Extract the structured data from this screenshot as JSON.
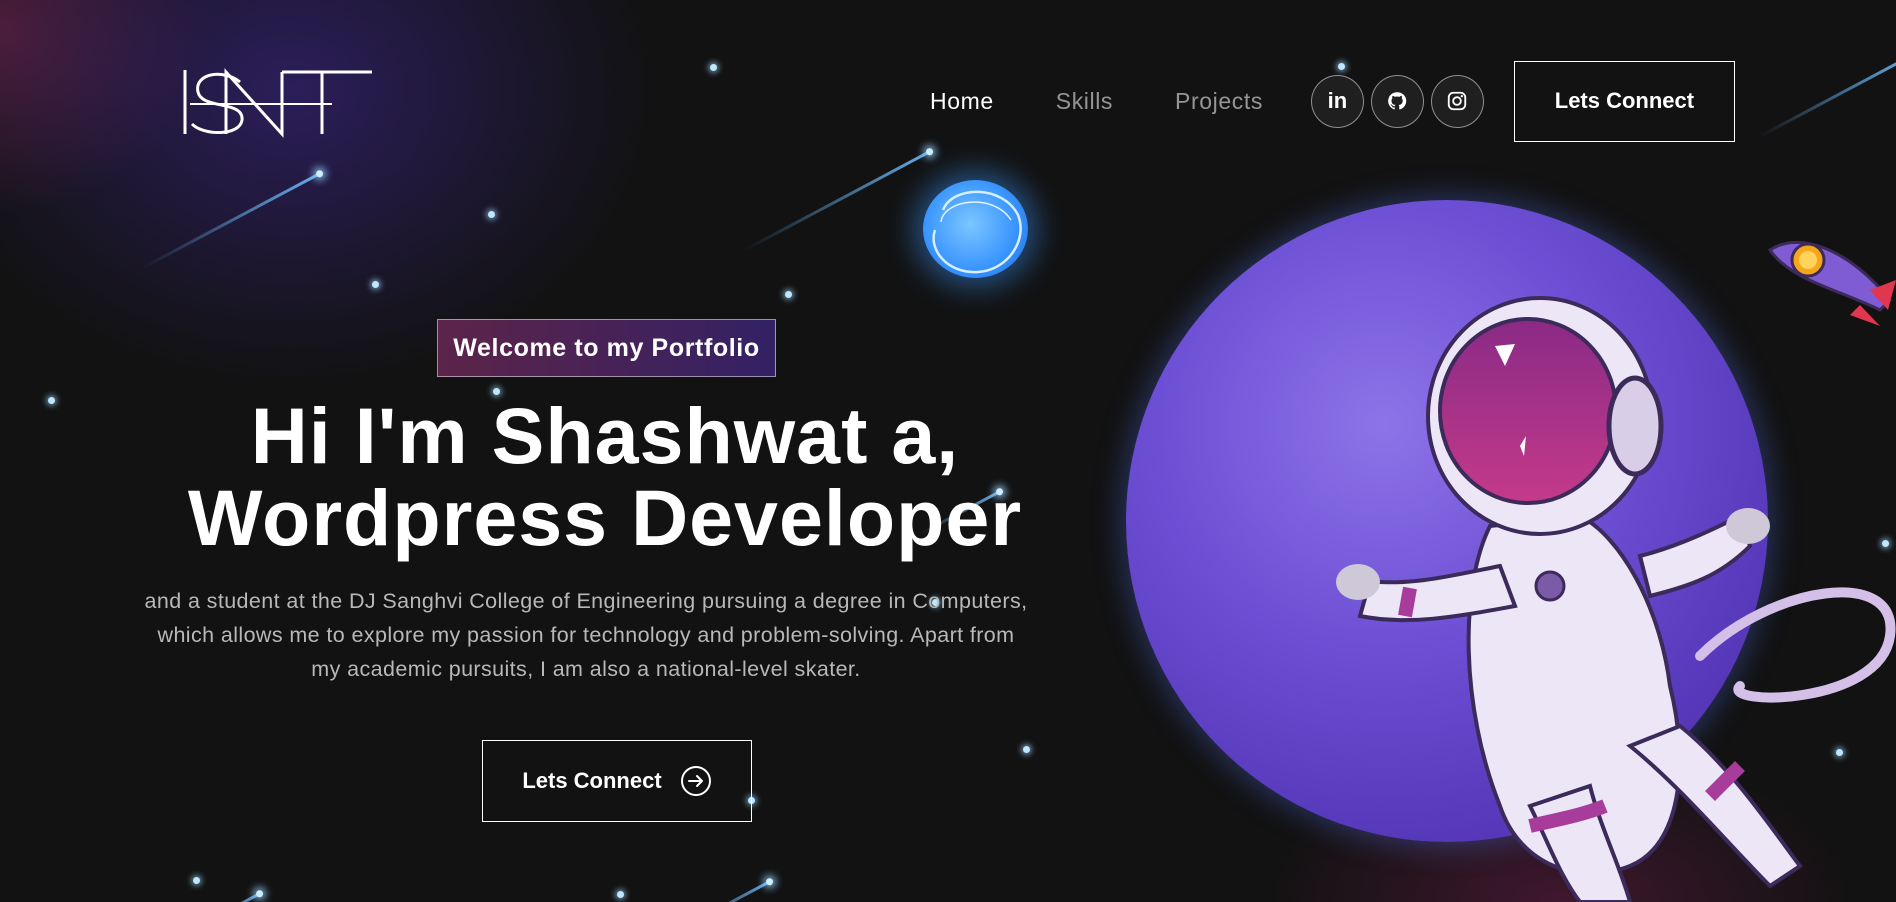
{
  "logo": {
    "alt": "ISNT logo"
  },
  "nav": {
    "links": [
      {
        "label": "Home",
        "active": true
      },
      {
        "label": "Skills",
        "active": false
      },
      {
        "label": "Projects",
        "active": false
      }
    ],
    "socials": [
      {
        "icon": "linkedin-icon",
        "glyph": "in"
      },
      {
        "icon": "github-icon"
      },
      {
        "icon": "instagram-icon"
      }
    ],
    "connect_label": "Lets Connect"
  },
  "hero": {
    "tagline": "Welcome to my Portfolio",
    "headline_line1": "Hi I'm Shashwat a,",
    "headline_line2": "Wordpress Developer",
    "bio": "and a student at the DJ Sanghvi College of Engineering pursuing a degree in Computers, which allows me to explore my passion for technology and problem-solving. Apart from my academic pursuits, I am also a national-level skater.",
    "cta_label": "Lets Connect",
    "cta_icon": "arrow-right-circle-icon"
  },
  "colors": {
    "background": "#121212",
    "tagline_gradient_start": "#AA367C",
    "tagline_gradient_end": "#4A2FBD",
    "planet": "#6C4FD4",
    "moon": "#3C97FF"
  }
}
